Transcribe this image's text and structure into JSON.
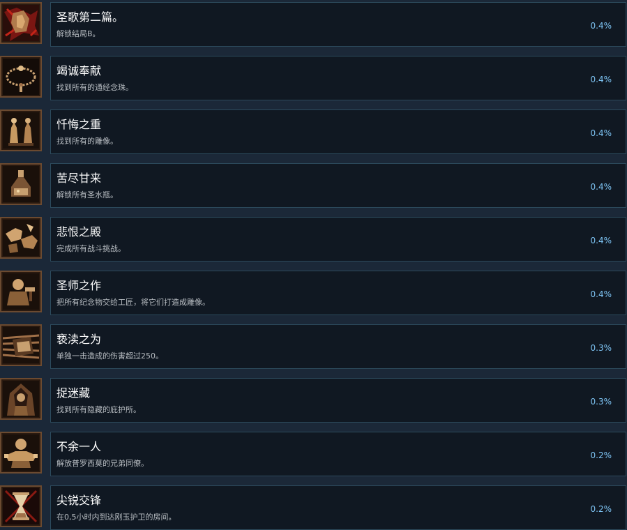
{
  "achievements": [
    {
      "title": "圣歌第二篇。",
      "description": "解锁结局B。",
      "percent": "0.4%",
      "icon": "bloody-hand-icon"
    },
    {
      "title": "竭诚奉献",
      "description": "找到所有的通经念珠。",
      "percent": "0.4%",
      "icon": "rosary-beads-icon"
    },
    {
      "title": "忏悔之重",
      "description": "找到所有的雕像。",
      "percent": "0.4%",
      "icon": "figurines-icon"
    },
    {
      "title": "苦尽甘来",
      "description": "解锁所有圣水瓶。",
      "percent": "0.4%",
      "icon": "flask-icon"
    },
    {
      "title": "悲恨之殿",
      "description": "完成所有战斗挑战。",
      "percent": "0.4%",
      "icon": "fists-icon"
    },
    {
      "title": "圣师之作",
      "description": "把所有纪念物交给工匠，将它们打造成雕像。",
      "percent": "0.4%",
      "icon": "artisan-icon"
    },
    {
      "title": "亵渎之为",
      "description": "单独一击造成的伤害超过250。",
      "percent": "0.3%",
      "icon": "sword-slash-icon"
    },
    {
      "title": "捉迷藏",
      "description": "找到所有隐藏的庇护所。",
      "percent": "0.3%",
      "icon": "hooded-figure-icon"
    },
    {
      "title": "不余一人",
      "description": "解放普罗西莫的兄弟同僚。",
      "percent": "0.2%",
      "icon": "freed-prisoner-icon"
    },
    {
      "title": "尖锐交锋",
      "description": "在0,5小时内到达刚玉护卫的房间。",
      "percent": "0.2%",
      "icon": "hourglass-icon"
    }
  ]
}
